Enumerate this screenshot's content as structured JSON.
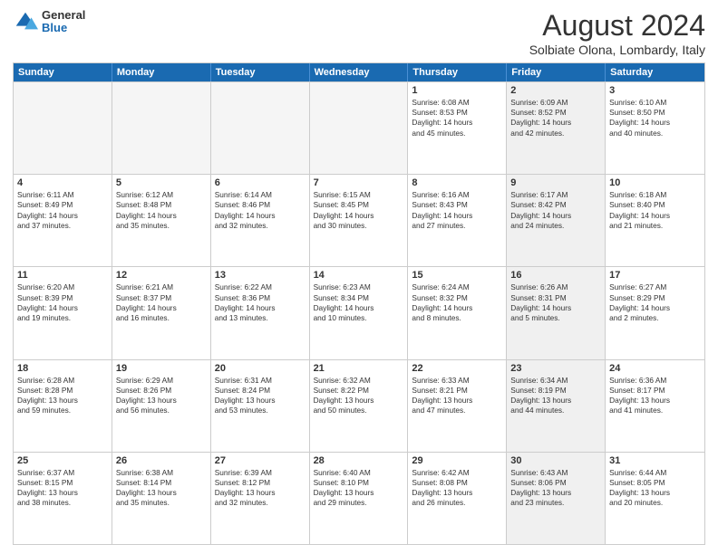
{
  "header": {
    "logo_general": "General",
    "logo_blue": "Blue",
    "month_title": "August 2024",
    "location": "Solbiate Olona, Lombardy, Italy"
  },
  "weekdays": [
    "Sunday",
    "Monday",
    "Tuesday",
    "Wednesday",
    "Thursday",
    "Friday",
    "Saturday"
  ],
  "rows": [
    [
      {
        "day": "",
        "lines": [],
        "empty": true
      },
      {
        "day": "",
        "lines": [],
        "empty": true
      },
      {
        "day": "",
        "lines": [],
        "empty": true
      },
      {
        "day": "",
        "lines": [],
        "empty": true
      },
      {
        "day": "1",
        "lines": [
          "Sunrise: 6:08 AM",
          "Sunset: 8:53 PM",
          "Daylight: 14 hours",
          "and 45 minutes."
        ],
        "shaded": false
      },
      {
        "day": "2",
        "lines": [
          "Sunrise: 6:09 AM",
          "Sunset: 8:52 PM",
          "Daylight: 14 hours",
          "and 42 minutes."
        ],
        "shaded": true
      },
      {
        "day": "3",
        "lines": [
          "Sunrise: 6:10 AM",
          "Sunset: 8:50 PM",
          "Daylight: 14 hours",
          "and 40 minutes."
        ],
        "shaded": false
      }
    ],
    [
      {
        "day": "4",
        "lines": [
          "Sunrise: 6:11 AM",
          "Sunset: 8:49 PM",
          "Daylight: 14 hours",
          "and 37 minutes."
        ],
        "shaded": false
      },
      {
        "day": "5",
        "lines": [
          "Sunrise: 6:12 AM",
          "Sunset: 8:48 PM",
          "Daylight: 14 hours",
          "and 35 minutes."
        ],
        "shaded": false
      },
      {
        "day": "6",
        "lines": [
          "Sunrise: 6:14 AM",
          "Sunset: 8:46 PM",
          "Daylight: 14 hours",
          "and 32 minutes."
        ],
        "shaded": false
      },
      {
        "day": "7",
        "lines": [
          "Sunrise: 6:15 AM",
          "Sunset: 8:45 PM",
          "Daylight: 14 hours",
          "and 30 minutes."
        ],
        "shaded": false
      },
      {
        "day": "8",
        "lines": [
          "Sunrise: 6:16 AM",
          "Sunset: 8:43 PM",
          "Daylight: 14 hours",
          "and 27 minutes."
        ],
        "shaded": false
      },
      {
        "day": "9",
        "lines": [
          "Sunrise: 6:17 AM",
          "Sunset: 8:42 PM",
          "Daylight: 14 hours",
          "and 24 minutes."
        ],
        "shaded": true
      },
      {
        "day": "10",
        "lines": [
          "Sunrise: 6:18 AM",
          "Sunset: 8:40 PM",
          "Daylight: 14 hours",
          "and 21 minutes."
        ],
        "shaded": false
      }
    ],
    [
      {
        "day": "11",
        "lines": [
          "Sunrise: 6:20 AM",
          "Sunset: 8:39 PM",
          "Daylight: 14 hours",
          "and 19 minutes."
        ],
        "shaded": false
      },
      {
        "day": "12",
        "lines": [
          "Sunrise: 6:21 AM",
          "Sunset: 8:37 PM",
          "Daylight: 14 hours",
          "and 16 minutes."
        ],
        "shaded": false
      },
      {
        "day": "13",
        "lines": [
          "Sunrise: 6:22 AM",
          "Sunset: 8:36 PM",
          "Daylight: 14 hours",
          "and 13 minutes."
        ],
        "shaded": false
      },
      {
        "day": "14",
        "lines": [
          "Sunrise: 6:23 AM",
          "Sunset: 8:34 PM",
          "Daylight: 14 hours",
          "and 10 minutes."
        ],
        "shaded": false
      },
      {
        "day": "15",
        "lines": [
          "Sunrise: 6:24 AM",
          "Sunset: 8:32 PM",
          "Daylight: 14 hours",
          "and 8 minutes."
        ],
        "shaded": false
      },
      {
        "day": "16",
        "lines": [
          "Sunrise: 6:26 AM",
          "Sunset: 8:31 PM",
          "Daylight: 14 hours",
          "and 5 minutes."
        ],
        "shaded": true
      },
      {
        "day": "17",
        "lines": [
          "Sunrise: 6:27 AM",
          "Sunset: 8:29 PM",
          "Daylight: 14 hours",
          "and 2 minutes."
        ],
        "shaded": false
      }
    ],
    [
      {
        "day": "18",
        "lines": [
          "Sunrise: 6:28 AM",
          "Sunset: 8:28 PM",
          "Daylight: 13 hours",
          "and 59 minutes."
        ],
        "shaded": false
      },
      {
        "day": "19",
        "lines": [
          "Sunrise: 6:29 AM",
          "Sunset: 8:26 PM",
          "Daylight: 13 hours",
          "and 56 minutes."
        ],
        "shaded": false
      },
      {
        "day": "20",
        "lines": [
          "Sunrise: 6:31 AM",
          "Sunset: 8:24 PM",
          "Daylight: 13 hours",
          "and 53 minutes."
        ],
        "shaded": false
      },
      {
        "day": "21",
        "lines": [
          "Sunrise: 6:32 AM",
          "Sunset: 8:22 PM",
          "Daylight: 13 hours",
          "and 50 minutes."
        ],
        "shaded": false
      },
      {
        "day": "22",
        "lines": [
          "Sunrise: 6:33 AM",
          "Sunset: 8:21 PM",
          "Daylight: 13 hours",
          "and 47 minutes."
        ],
        "shaded": false
      },
      {
        "day": "23",
        "lines": [
          "Sunrise: 6:34 AM",
          "Sunset: 8:19 PM",
          "Daylight: 13 hours",
          "and 44 minutes."
        ],
        "shaded": true
      },
      {
        "day": "24",
        "lines": [
          "Sunrise: 6:36 AM",
          "Sunset: 8:17 PM",
          "Daylight: 13 hours",
          "and 41 minutes."
        ],
        "shaded": false
      }
    ],
    [
      {
        "day": "25",
        "lines": [
          "Sunrise: 6:37 AM",
          "Sunset: 8:15 PM",
          "Daylight: 13 hours",
          "and 38 minutes."
        ],
        "shaded": false
      },
      {
        "day": "26",
        "lines": [
          "Sunrise: 6:38 AM",
          "Sunset: 8:14 PM",
          "Daylight: 13 hours",
          "and 35 minutes."
        ],
        "shaded": false
      },
      {
        "day": "27",
        "lines": [
          "Sunrise: 6:39 AM",
          "Sunset: 8:12 PM",
          "Daylight: 13 hours",
          "and 32 minutes."
        ],
        "shaded": false
      },
      {
        "day": "28",
        "lines": [
          "Sunrise: 6:40 AM",
          "Sunset: 8:10 PM",
          "Daylight: 13 hours",
          "and 29 minutes."
        ],
        "shaded": false
      },
      {
        "day": "29",
        "lines": [
          "Sunrise: 6:42 AM",
          "Sunset: 8:08 PM",
          "Daylight: 13 hours",
          "and 26 minutes."
        ],
        "shaded": false
      },
      {
        "day": "30",
        "lines": [
          "Sunrise: 6:43 AM",
          "Sunset: 8:06 PM",
          "Daylight: 13 hours",
          "and 23 minutes."
        ],
        "shaded": true
      },
      {
        "day": "31",
        "lines": [
          "Sunrise: 6:44 AM",
          "Sunset: 8:05 PM",
          "Daylight: 13 hours",
          "and 20 minutes."
        ],
        "shaded": false
      }
    ]
  ]
}
